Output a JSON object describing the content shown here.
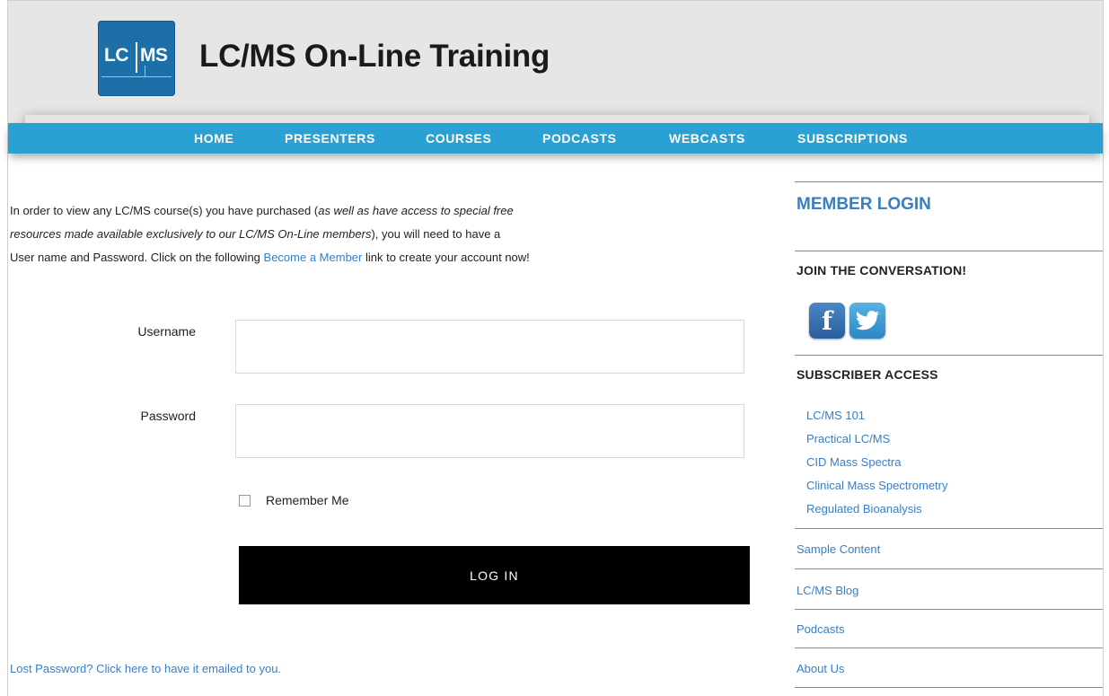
{
  "header": {
    "logo_left": "LC",
    "logo_right": "MS",
    "title": "LC/MS On-Line Training"
  },
  "nav": {
    "items": [
      {
        "label": "HOME"
      },
      {
        "label": "PRESENTERS"
      },
      {
        "label": "COURSES"
      },
      {
        "label": "PODCASTS"
      },
      {
        "label": "WEBCASTS"
      },
      {
        "label": "SUBSCRIPTIONS"
      }
    ]
  },
  "intro": {
    "part1": "In order to view any LC/MS course(s) you have purchased (",
    "italic1": "as well as have access to special free",
    "italic2": "resources made available exclusively to our LC/MS On-Line members",
    "part2": "), you will need to have a",
    "part3": "User name and Password.  Click on the following ",
    "link": "Become a Member",
    "part4": " link to create your account now!"
  },
  "form": {
    "username_label": "Username",
    "username_value": "",
    "password_label": "Password",
    "password_value": "",
    "remember_label": "Remember Me",
    "remember_checked": false,
    "submit_label": "LOG IN",
    "lost_password": "Lost Password? Click here to have it emailed to you."
  },
  "sidebar": {
    "member_login": "MEMBER LOGIN",
    "join_heading": "JOIN THE CONVERSATION!",
    "social": [
      {
        "name": "facebook-icon",
        "glyph": "f"
      },
      {
        "name": "twitter-icon",
        "glyph": ""
      }
    ],
    "subscriber_heading": "SUBSCRIBER ACCESS",
    "subscriber_links": [
      "LC/MS 101",
      "Practical LC/MS",
      "CID Mass Spectra",
      "Clinical Mass Spectrometry",
      "Regulated Bioanalysis"
    ],
    "links": [
      "Sample Content",
      "LC/MS Blog",
      "Podcasts",
      "About Us"
    ]
  },
  "colors": {
    "nav_bg": "#29a1d3",
    "link": "#3a7ec4",
    "header_bg": "#e6e6e6",
    "logo_bg": "#1d6fa8",
    "button_bg": "#000000"
  }
}
